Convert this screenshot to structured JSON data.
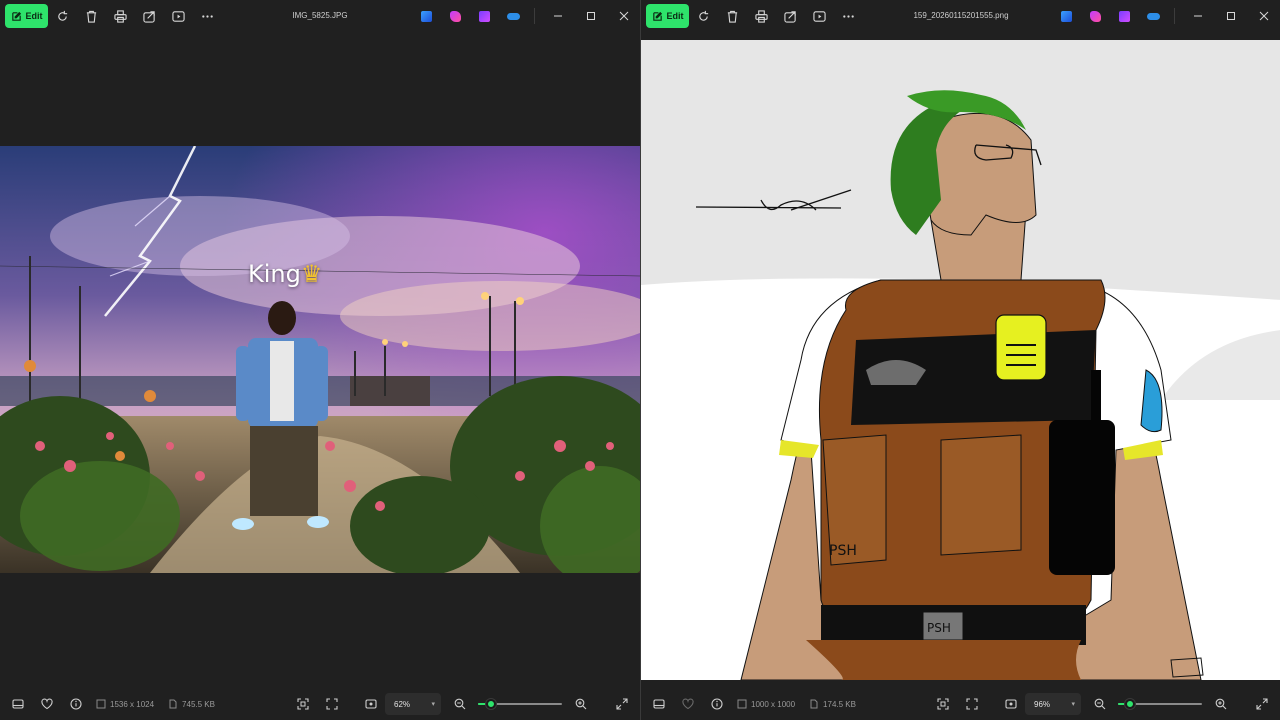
{
  "left_window": {
    "edit_label": "Edit",
    "title": "IMG_5825.JPG",
    "image_caption": "King",
    "status": {
      "dimensions": "1536 x 1024",
      "file_size": "745.5 KB",
      "zoom": "62%",
      "zoom_fraction": 0.15
    }
  },
  "right_window": {
    "edit_label": "Edit",
    "title": "159_20260115201555.png",
    "image_caption": "PSH",
    "status": {
      "dimensions": "1000 x 1000",
      "file_size": "174.5 KB",
      "zoom": "96%",
      "zoom_fraction": 0.14
    }
  },
  "colors": {
    "accent": "#2ee36b",
    "background": "#202020"
  },
  "icons": {
    "toolbar": [
      "edit-icon",
      "rotate-icon",
      "delete-icon",
      "print-icon",
      "share-icon",
      "slideshow-icon",
      "more-icon"
    ],
    "apps": [
      "designer-icon",
      "clipchamp-icon",
      "copilot-icon",
      "onedrive-icon"
    ],
    "window": [
      "minimize-icon",
      "maximize-icon",
      "close-icon"
    ],
    "status": [
      "filmstrip-icon",
      "favorite-icon",
      "info-icon",
      "fit-icon",
      "fullscreen-icon",
      "zoom-out-icon",
      "zoom-in-icon",
      "expand-icon"
    ]
  }
}
